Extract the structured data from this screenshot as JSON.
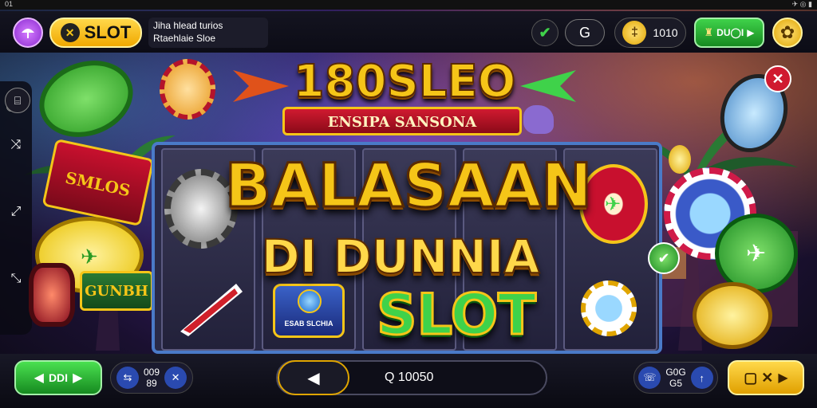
{
  "status": {
    "left": "01",
    "right": "✈ ◎ ▮"
  },
  "header": {
    "brand_label": "SLOT",
    "subtitle_line1": "Jiha hlead turios",
    "subtitle_line2": "Rtaehlaie Sloe",
    "balance": "1010",
    "action_label": "DU◯I"
  },
  "logo": {
    "title": "180SLEO",
    "banner": "ENSIPA SANSONA"
  },
  "headline": {
    "line1": "BALASAAN",
    "line2": "DI DUNNIA",
    "line3": "SLOT"
  },
  "left_sign": {
    "top": "SMLOS",
    "bottom": "GUNBH"
  },
  "small_badge": "ESAB SLCHIA",
  "bottom": {
    "left_button": "DDI",
    "left_stat_top": "009",
    "left_stat_bottom": "89",
    "search_value": "Q 10050",
    "right_stat_top": "G0G",
    "right_stat_bottom": "G5",
    "right_button": "▢ ✕"
  },
  "colors": {
    "gold": "#f5c518",
    "green": "#2fb43a",
    "purple": "#a63be0",
    "accent_red": "#c8102e"
  }
}
